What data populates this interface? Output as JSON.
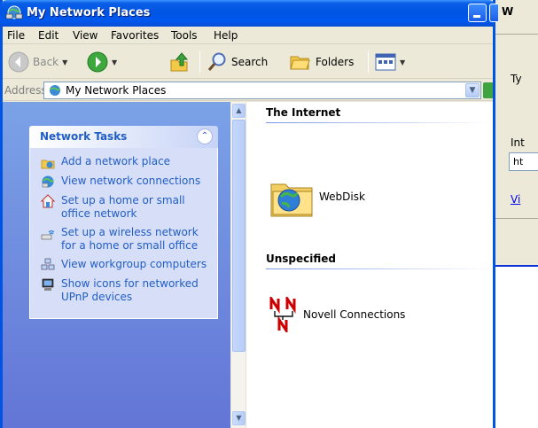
{
  "dialog": {
    "heading": "W",
    "type_label": "Ty",
    "int_label": "Int",
    "url_value": "ht",
    "view_link": "Vi"
  },
  "window": {
    "title": "My Network Places",
    "menu": [
      "File",
      "Edit",
      "View",
      "Favorites",
      "Tools",
      "Help"
    ],
    "toolbar": {
      "back": "Back",
      "search": "Search",
      "folders": "Folders"
    },
    "address": {
      "label": "Address",
      "value": "My Network Places"
    }
  },
  "taskpane": {
    "title": "Network Tasks",
    "tasks": [
      {
        "label": "Add a network place",
        "icon": "add-network-place-icon"
      },
      {
        "label": "View network connections",
        "icon": "network-connections-icon"
      },
      {
        "label": "Set up a home or small office network",
        "icon": "home-network-icon"
      },
      {
        "label": "Set up a wireless network for a home or small office",
        "icon": "wireless-network-icon"
      },
      {
        "label": "View workgroup computers",
        "icon": "workgroup-computers-icon"
      },
      {
        "label": "Show icons for networked UPnP devices",
        "icon": "upnp-devices-icon"
      }
    ]
  },
  "content": {
    "groups": [
      {
        "title": "The Internet",
        "items": [
          {
            "label": "WebDisk",
            "icon": "webdisk-folder-icon"
          }
        ]
      },
      {
        "title": "Unspecified",
        "items": [
          {
            "label": "Novell Connections",
            "icon": "novell-icon"
          }
        ]
      }
    ]
  },
  "colors": {
    "titlebar": "#0054e3",
    "taskpane_top": "#7ba2e7",
    "taskpane_bottom": "#6375d6",
    "task_link": "#215dc6"
  }
}
